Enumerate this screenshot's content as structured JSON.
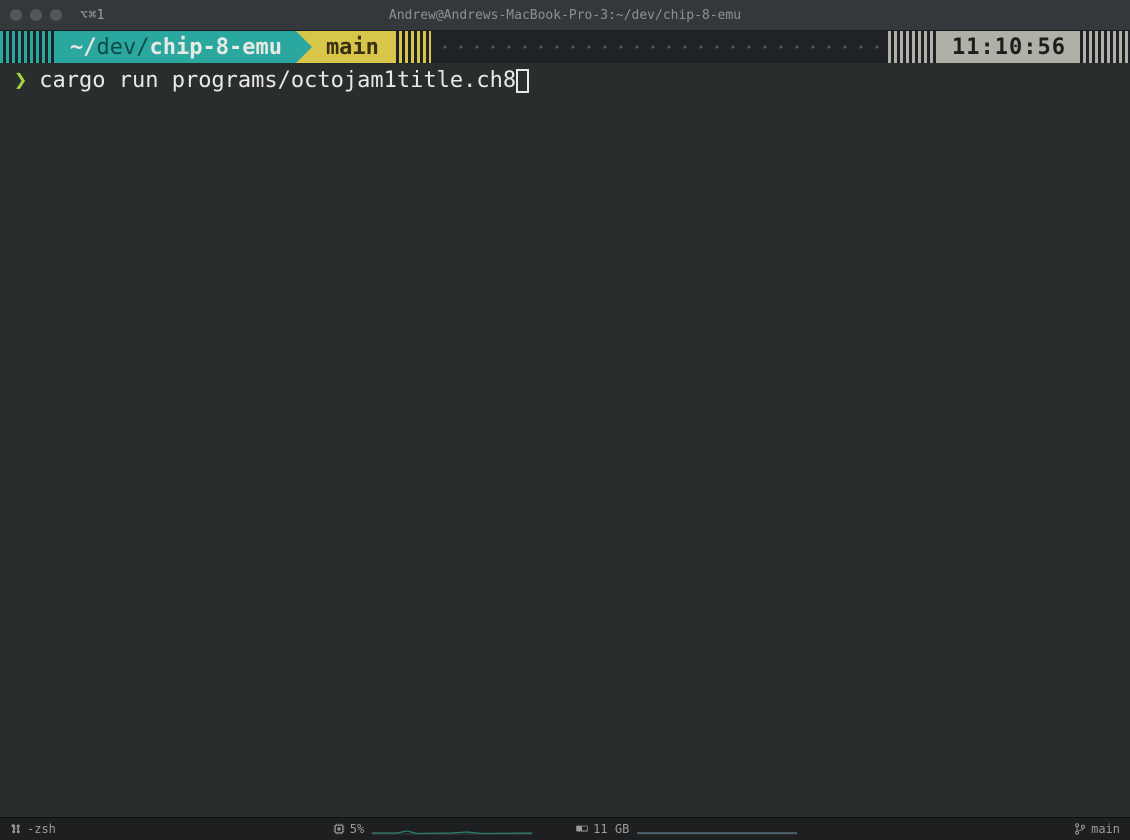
{
  "titlebar": {
    "tab_shortcut": "⌥⌘1",
    "title": "Andrew@Andrews-MacBook-Pro-3:~/dev/chip-8-emu"
  },
  "statusline": {
    "path_prefix": "~/",
    "path_dim": "dev/",
    "path_bold": "chip-8-emu",
    "branch": "main",
    "clock": "11:10:56"
  },
  "prompt": {
    "symbol": "❯",
    "command": "cargo run programs/octojam1title.ch8"
  },
  "bottombar": {
    "shell": "-zsh",
    "cpu_pct": "5%",
    "mem": "11 GB",
    "git_branch": "main"
  }
}
